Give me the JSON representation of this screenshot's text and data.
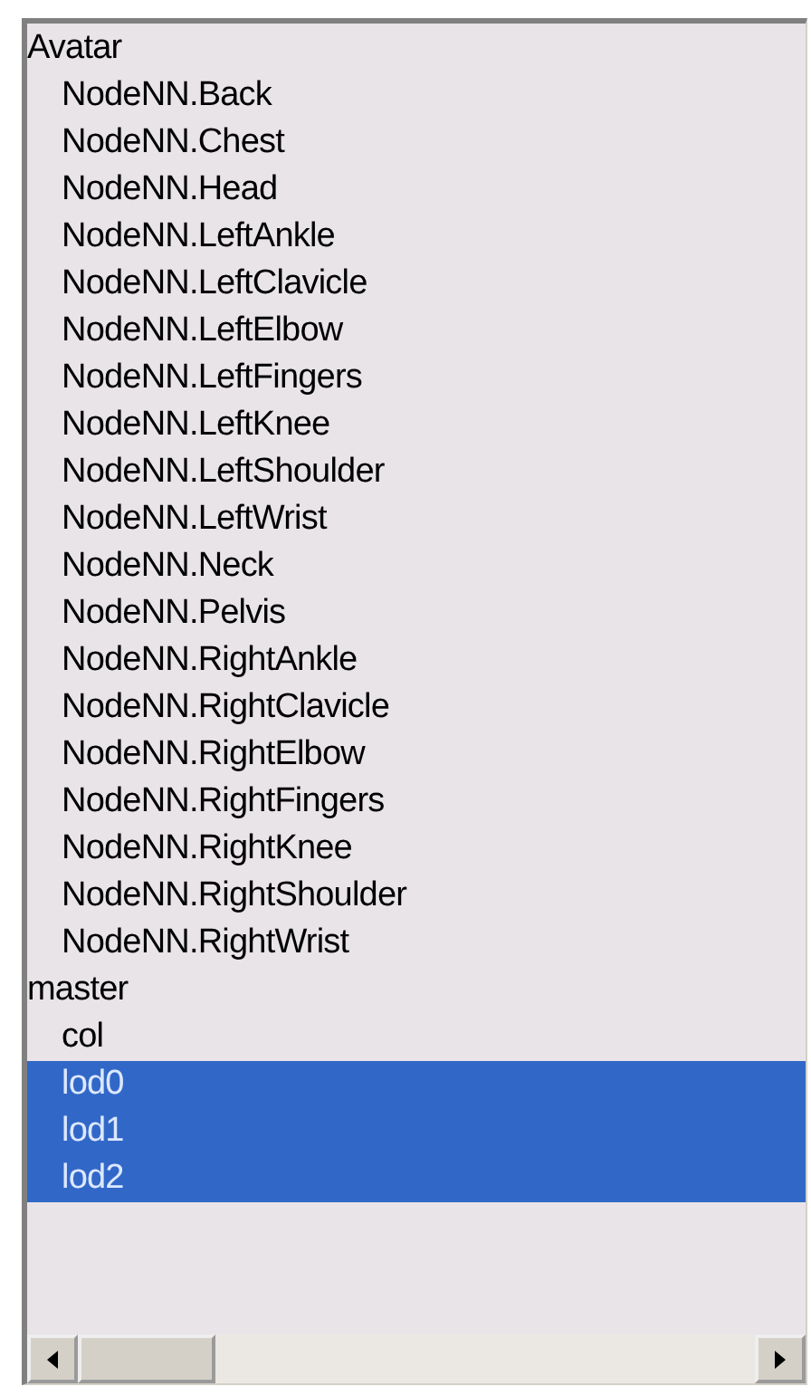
{
  "tree": [
    {
      "label": "Avatar",
      "selected": false,
      "children": [
        {
          "label": "NodeNN.Back",
          "selected": false
        },
        {
          "label": "NodeNN.Chest",
          "selected": false
        },
        {
          "label": "NodeNN.Head",
          "selected": false
        },
        {
          "label": "NodeNN.LeftAnkle",
          "selected": false
        },
        {
          "label": "NodeNN.LeftClavicle",
          "selected": false
        },
        {
          "label": "NodeNN.LeftElbow",
          "selected": false
        },
        {
          "label": "NodeNN.LeftFingers",
          "selected": false
        },
        {
          "label": "NodeNN.LeftKnee",
          "selected": false
        },
        {
          "label": "NodeNN.LeftShoulder",
          "selected": false
        },
        {
          "label": "NodeNN.LeftWrist",
          "selected": false
        },
        {
          "label": "NodeNN.Neck",
          "selected": false
        },
        {
          "label": "NodeNN.Pelvis",
          "selected": false
        },
        {
          "label": "NodeNN.RightAnkle",
          "selected": false
        },
        {
          "label": "NodeNN.RightClavicle",
          "selected": false
        },
        {
          "label": "NodeNN.RightElbow",
          "selected": false
        },
        {
          "label": "NodeNN.RightFingers",
          "selected": false
        },
        {
          "label": "NodeNN.RightKnee",
          "selected": false
        },
        {
          "label": "NodeNN.RightShoulder",
          "selected": false
        },
        {
          "label": "NodeNN.RightWrist",
          "selected": false
        }
      ]
    },
    {
      "label": "master",
      "selected": false,
      "children": [
        {
          "label": "col",
          "selected": false
        },
        {
          "label": "lod0",
          "selected": true
        },
        {
          "label": "lod1",
          "selected": true
        },
        {
          "label": "lod2",
          "selected": true
        }
      ]
    }
  ]
}
